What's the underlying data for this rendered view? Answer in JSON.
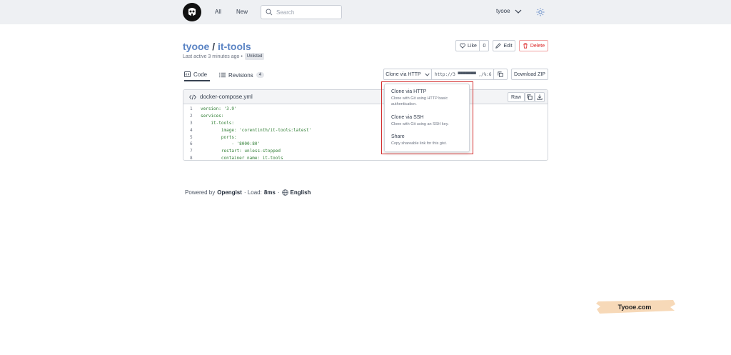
{
  "nav": {
    "all": "All",
    "new": "New",
    "search_placeholder": "Search",
    "user": "tyooe"
  },
  "gist": {
    "owner": "tyooe",
    "separator": "/",
    "name": "it-tools",
    "last_active": "Last active 3 minutes ago •",
    "visibility": "Unlisted"
  },
  "actions": {
    "like": "Like",
    "like_count": "0",
    "edit": "Edit",
    "delete": "Delete"
  },
  "tabs": {
    "code": "Code",
    "revisions": "Revisions",
    "revisions_count": "4"
  },
  "clone": {
    "button": "Clone via HTTP",
    "url": "http://3   ▀▀▀▀▀▀▀ ,/%:6",
    "download": "Download ZIP"
  },
  "dropdown": [
    {
      "title": "Clone via HTTP",
      "desc": "Clone with Git using HTTP basic authentication."
    },
    {
      "title": "Clone via SSH",
      "desc": "Clone with Git using an SSH key."
    },
    {
      "title": "Share",
      "desc": "Copy shareable link for this gist."
    }
  ],
  "file": {
    "name": "docker-compose.yml",
    "raw": "Raw",
    "lines": [
      {
        "n": "1",
        "text": "version: '3.9'"
      },
      {
        "n": "2",
        "text": "services:"
      },
      {
        "n": "3",
        "text": "    it-tools:"
      },
      {
        "n": "4",
        "text": "        image: 'corentinth/it-tools:latest'"
      },
      {
        "n": "5",
        "text": "        ports:"
      },
      {
        "n": "6",
        "text": "            - '8000:80'"
      },
      {
        "n": "7",
        "text": "        restart: unless-stopped"
      },
      {
        "n": "8",
        "text": "        container_name: it-tools"
      }
    ]
  },
  "footer": {
    "powered": "Powered by",
    "brand": "Opengist",
    "load_label": "· Load:",
    "load_value": "8ms",
    "sep": "·",
    "language": "English"
  },
  "watermark": "Tyooe.com",
  "colors": {
    "accent": "#5b84c4",
    "danger": "#dc2626",
    "highlight": "#d32f2f"
  }
}
